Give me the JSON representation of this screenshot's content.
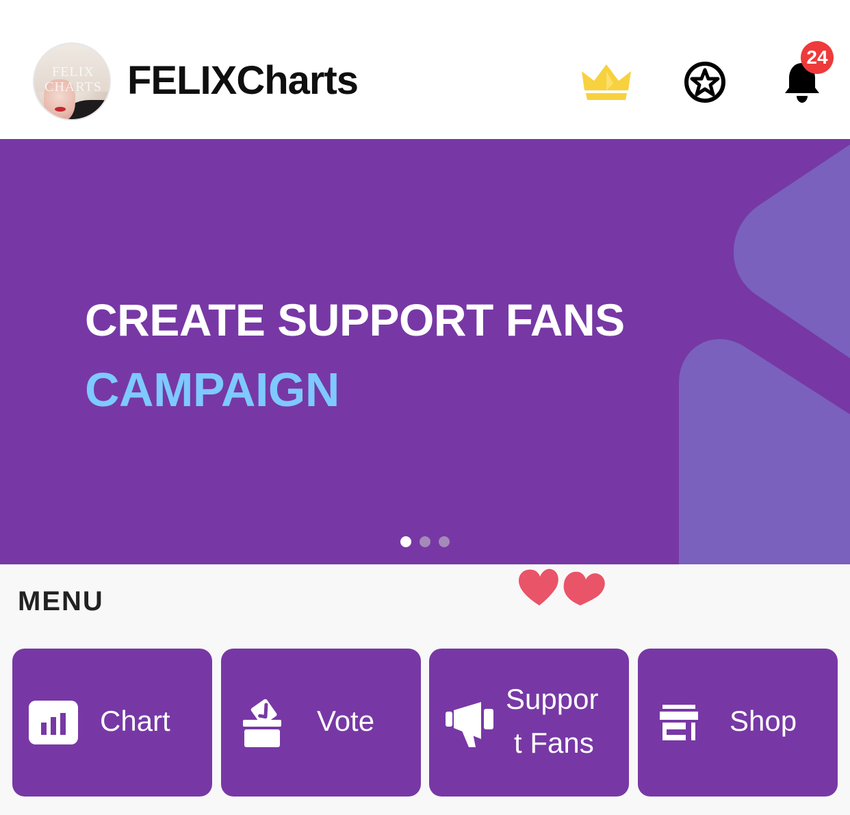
{
  "header": {
    "avatar_text": "FELIX CHARTS",
    "brand": "FELIXCharts",
    "notification_count": "24",
    "colors": {
      "crown": "#f7d23e",
      "badge": "#ee3a3a"
    }
  },
  "banner": {
    "title": "CREATE SUPPORT FANS",
    "subtitle": "CAMPAIGN",
    "slide_count": 3,
    "active_slide": 1,
    "colors": {
      "background": "#7738a5",
      "accent": "#7ec9ff",
      "shape": "#7a61bd"
    }
  },
  "menu": {
    "label": "MENU",
    "tiles": [
      {
        "label": "Chart",
        "icon": "bar-chart-icon"
      },
      {
        "label": "Vote",
        "icon": "ballot-box-icon"
      },
      {
        "label_line1": "Suppor",
        "label_line2": "t Fans",
        "icon": "megaphone-icon"
      },
      {
        "label": "Shop",
        "icon": "storefront-icon"
      }
    ]
  }
}
